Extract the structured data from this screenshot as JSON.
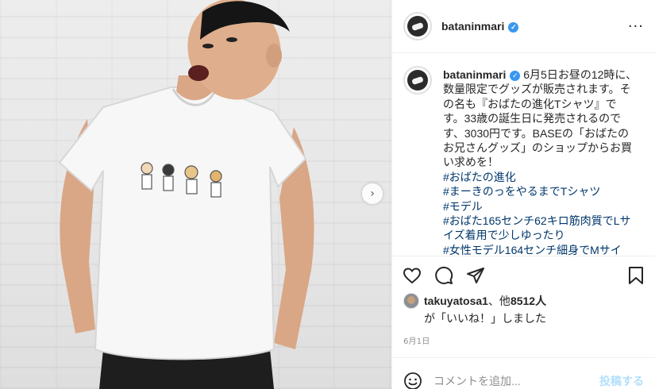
{
  "post": {
    "username": "batanínmari",
    "verified_mark": "✓",
    "more_icon": "more-options-icon"
  },
  "caption": {
    "username": "bataninmari",
    "lines": [
      " 6月5日お昼の12時に、",
      "数量限定でグッズが販売されます。そ",
      "の名も『おばたの進化Tシャツ』で",
      "す。33歳の誕生日に発売されるので",
      "す、3030円です。BASEの「おばたの",
      "お兄さんグッズ」のショップからお買",
      "い求めを！"
    ],
    "hashtags": [
      "#おばたの進化",
      "#まーきのっをやるまでTシャツ",
      "#モデル",
      "#おばた165センチ62キロ筋肉質でLサ",
      "イズ着用で少しゆったり",
      "#女性モデル164センチ細身でMサイ"
    ]
  },
  "likes": {
    "user": "takuyatosa1",
    "sep": "、他",
    "count": "8512人",
    "suffix": "が「いいね！」しました"
  },
  "date": "6月1日",
  "comment": {
    "placeholder": "コメントを追加...",
    "post_label": "投稿する"
  },
  "colors": {
    "verified": "#3897f0",
    "hashtag": "#00376b",
    "post_button_disabled": "#b2dffc"
  }
}
